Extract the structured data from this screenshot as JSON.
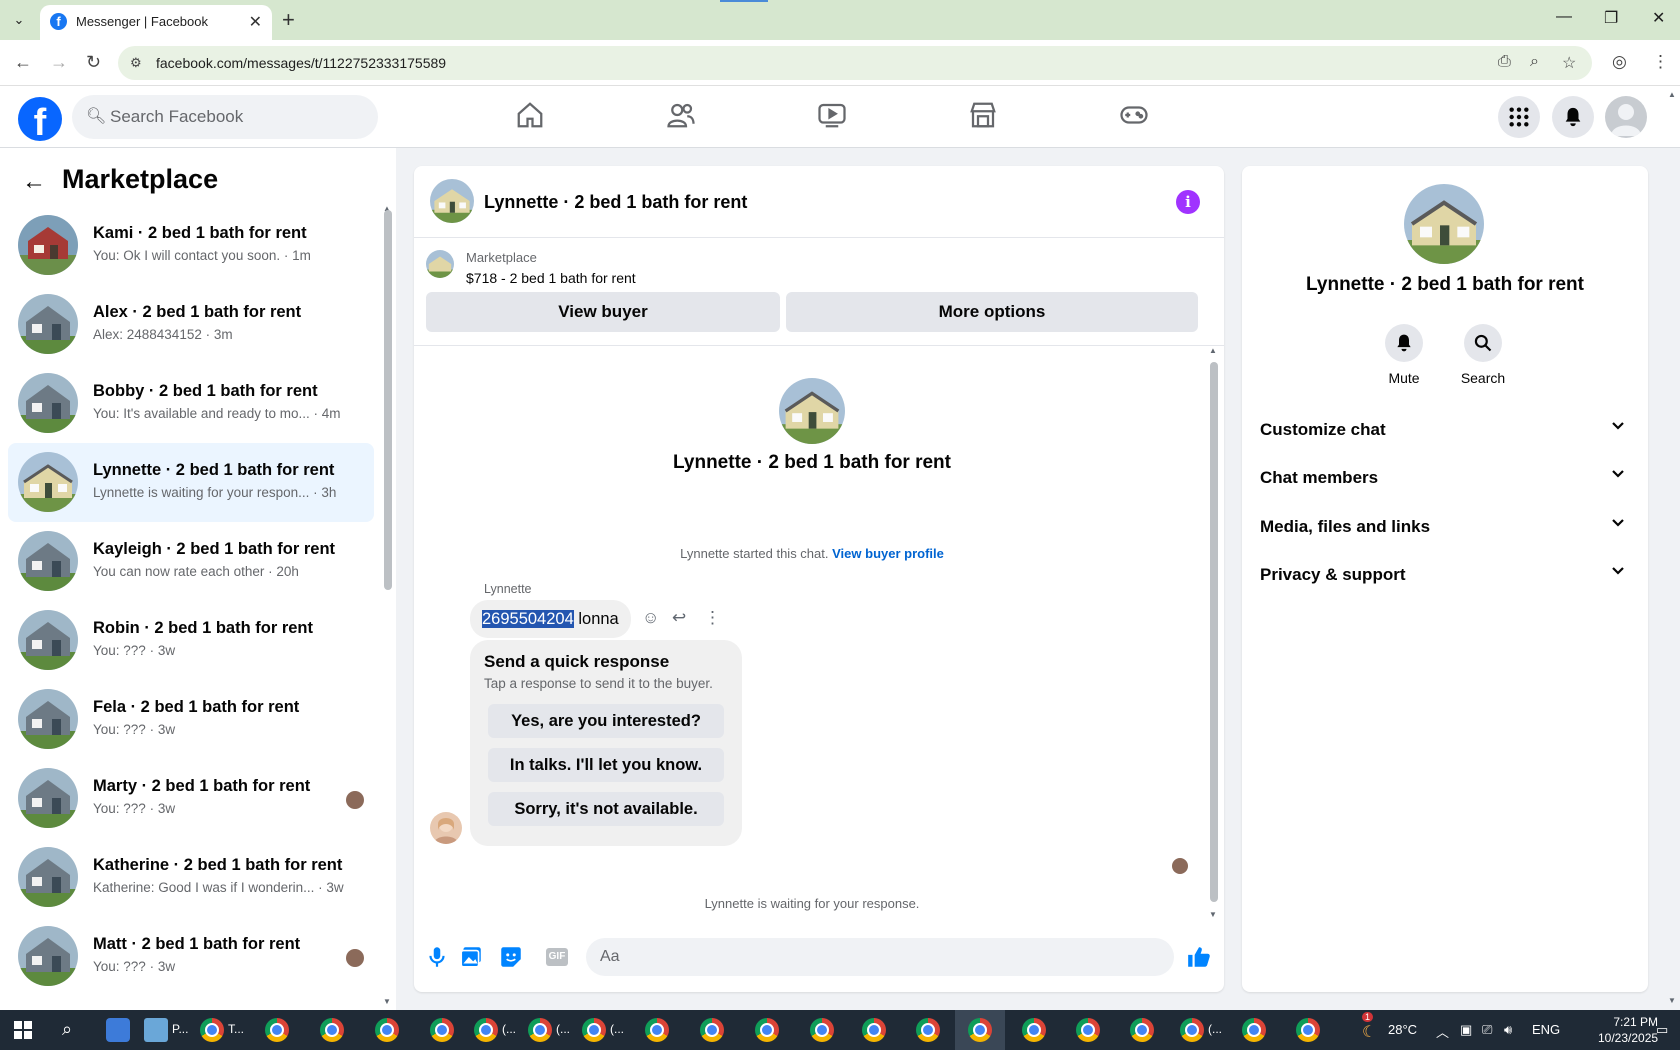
{
  "browser": {
    "tab_title": "Messenger | Facebook",
    "url": "facebook.com/messages/t/1122752333175589"
  },
  "fb": {
    "search_placeholder": "Search Facebook"
  },
  "left": {
    "title": "Marketplace",
    "conversations": [
      {
        "name": "Kami · 2 bed 1 bath for rent",
        "preview": "You: Ok I will contact you soon.",
        "time": "· 1m"
      },
      {
        "name": "Alex · 2 bed 1 bath for rent",
        "preview": "Alex: 2488434152",
        "time": "· 3m"
      },
      {
        "name": "Bobby · 2 bed 1 bath for rent",
        "preview": "You: It's available and ready to mo...",
        "time": "· 4m"
      },
      {
        "name": "Lynnette · 2 bed 1 bath for rent",
        "preview": "Lynnette is waiting for your respon...",
        "time": "· 3h"
      },
      {
        "name": "Kayleigh · 2 bed 1 bath for rent",
        "preview": "You can now rate each other",
        "time": "· 20h"
      },
      {
        "name": "Robin · 2 bed 1 bath for rent",
        "preview": "You: ???",
        "time": "· 3w"
      },
      {
        "name": "Fela · 2 bed 1 bath for rent",
        "preview": "You: ???",
        "time": "· 3w"
      },
      {
        "name": "Marty · 2 bed 1 bath for rent",
        "preview": "You: ???",
        "time": "· 3w"
      },
      {
        "name": "Katherine · 2 bed 1 bath for rent",
        "preview": "Katherine: Good I was if I wonderin...",
        "time": "· 3w"
      },
      {
        "name": "Matt · 2 bed 1 bath for rent",
        "preview": "You: ???",
        "time": "· 3w"
      }
    ]
  },
  "chat": {
    "title": "Lynnette · 2 bed 1 bath for rent",
    "marketplace_label": "Marketplace",
    "listing": "$718 - 2 bed 1 bath for rent",
    "view_buyer": "View buyer",
    "more_options": "More options",
    "intro_name": "Lynnette · 2 bed 1 bath for rent",
    "started_text": "Lynnette started this chat.",
    "view_buyer_profile": "View buyer profile",
    "sender": "Lynnette",
    "message_selected": "2695504204",
    "message_rest": " lonna",
    "quick_title": "Send a quick response",
    "quick_sub": "Tap a response to send it to the buyer.",
    "quick_responses": [
      "Yes, are you interested?",
      "In talks. I'll let you know.",
      "Sorry, it's not available."
    ],
    "waiting": "Lynnette is waiting for your response.",
    "composer_placeholder": "Aa"
  },
  "right": {
    "name": "Lynnette · 2 bed 1 bath for rent",
    "mute": "Mute",
    "search": "Search",
    "sections": [
      "Customize chat",
      "Chat members",
      "Media, files and links",
      "Privacy & support"
    ]
  },
  "taskbar": {
    "app1_label": "P...",
    "app2_label": "T...",
    "app3_label": "(...",
    "app4_label": "(...",
    "app5_label": "(...",
    "app6_label": "(...",
    "temp": "28°C",
    "lang": "ENG",
    "time": "7:21 PM",
    "date": "10/23/2025",
    "badge": "1"
  },
  "colors": {
    "fb_blue": "#0866ff",
    "active_item": "#ebf5ff",
    "link": "#0064d1",
    "info": "#a033ff"
  }
}
